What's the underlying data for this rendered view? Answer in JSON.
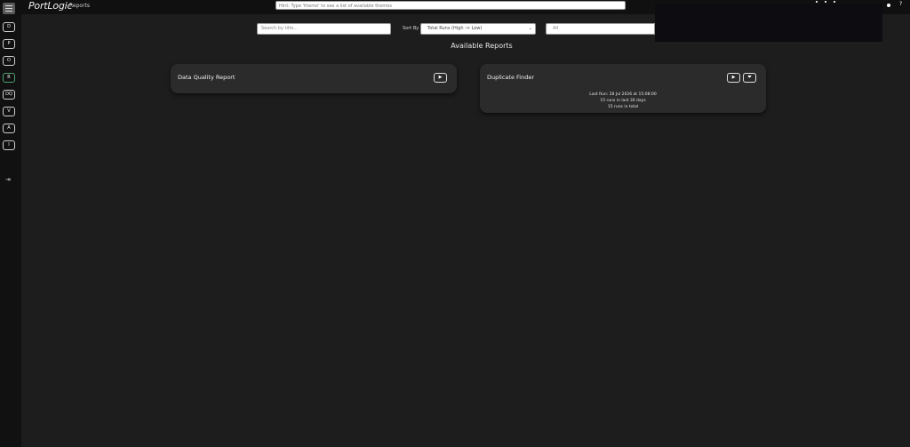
{
  "app": {
    "brand": "PortLogic",
    "section": "Reports",
    "command_placeholder": "Hint: Type 'theme' to see a list of available themes"
  },
  "sidebar": {
    "items": [
      {
        "label": "D"
      },
      {
        "label": "P"
      },
      {
        "label": "O"
      },
      {
        "label": "R"
      },
      {
        "label": "DQ"
      },
      {
        "label": "V"
      },
      {
        "label": "A"
      },
      {
        "label": "I"
      }
    ],
    "active_index": 3,
    "logout_glyph": "⇥"
  },
  "filters": {
    "search_placeholder": "Search by title...",
    "sort_label": "Sort By",
    "sort_value": "Total Runs (High -> Low)",
    "filter_value": "All"
  },
  "main": {
    "heading": "Available Reports",
    "reports": [
      {
        "title": "Data Quality Report",
        "run_glyph": "▶"
      },
      {
        "title": "Duplicate Finder",
        "run_glyph": "▶",
        "fav_glyph": "❤",
        "last_run": "Last Run: 28 Jul 2026 at 15:08:00",
        "runs_30": "15 runs in last 30 days",
        "runs_total": "15 runs in total"
      }
    ]
  },
  "header_right": {
    "help_glyph": "?"
  },
  "colors": {
    "background": "#1d1d1d",
    "card": "#2b2b2b",
    "active_accent": "#4c9f72"
  }
}
